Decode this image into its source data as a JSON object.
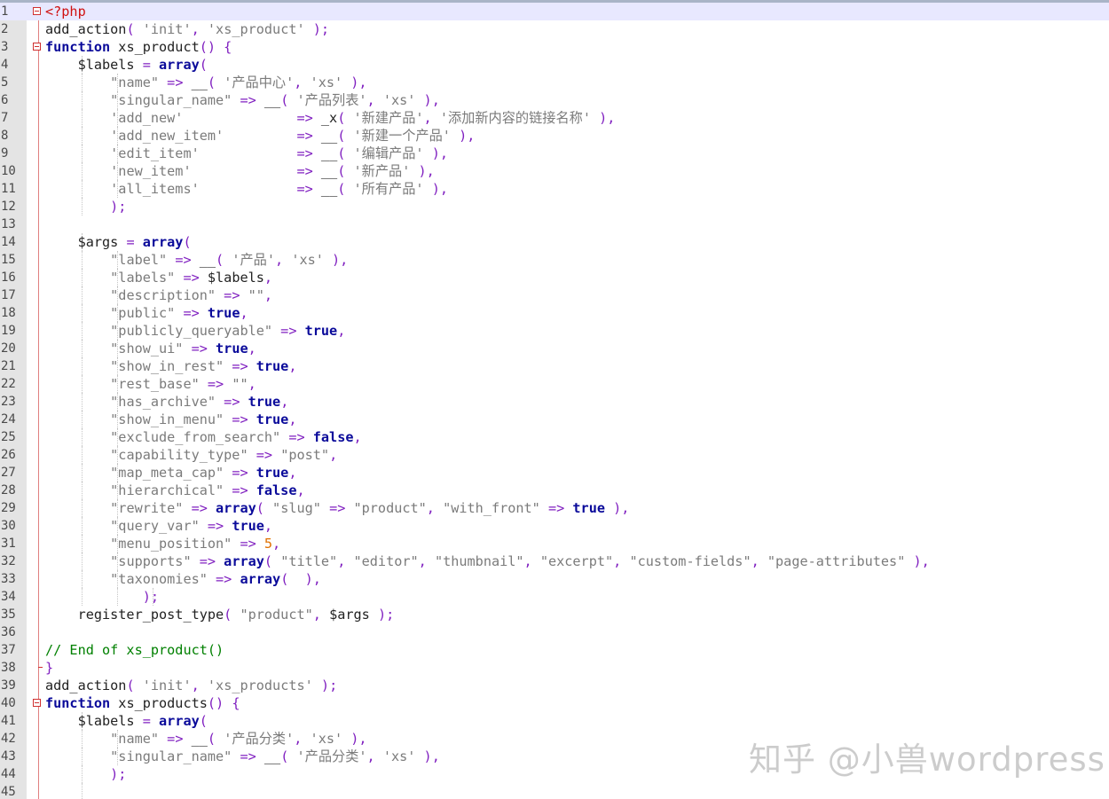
{
  "editor": {
    "current_line": 1,
    "line_numbers": [
      "1",
      "2",
      "3",
      "4",
      "5",
      "6",
      "7",
      "8",
      "9",
      "10",
      "11",
      "12",
      "13",
      "14",
      "15",
      "16",
      "17",
      "18",
      "19",
      "20",
      "21",
      "22",
      "23",
      "24",
      "25",
      "26",
      "27",
      "28",
      "29",
      "30",
      "31",
      "32",
      "33",
      "34",
      "35",
      "36",
      "37",
      "38",
      "39",
      "40",
      "41",
      "42",
      "43",
      "44",
      "45"
    ],
    "colors": {
      "keyword": "#0a0a9a",
      "string": "#7b7b7b",
      "operator": "#8020c0",
      "comment": "#008000",
      "number": "#e07000",
      "php_tag": "#d01010",
      "margin": "#e08080"
    },
    "fold_markers": [
      "1",
      "3",
      "40"
    ],
    "lines": [
      [
        [
          "x",
          "<?php"
        ]
      ],
      [
        [
          "t",
          "add_action"
        ],
        [
          "o",
          "( "
        ],
        [
          "s",
          "'init'"
        ],
        [
          "o",
          ", "
        ],
        [
          "s",
          "'xs_product'"
        ],
        [
          "o",
          " );"
        ]
      ],
      [
        [
          "k",
          "function"
        ],
        [
          "t",
          " xs_product"
        ],
        [
          "o",
          "() {"
        ]
      ],
      [
        [
          "t",
          "    $labels "
        ],
        [
          "o",
          "= "
        ],
        [
          "k",
          "array"
        ],
        [
          "o",
          "("
        ]
      ],
      [
        [
          "t",
          "        "
        ],
        [
          "s",
          "\"name\""
        ],
        [
          "o",
          " => "
        ],
        [
          "t",
          "__"
        ],
        [
          "o",
          "( "
        ],
        [
          "s",
          "'产品中心'"
        ],
        [
          "o",
          ", "
        ],
        [
          "s",
          "'xs'"
        ],
        [
          "o",
          " ),"
        ]
      ],
      [
        [
          "t",
          "        "
        ],
        [
          "s",
          "\"singular_name\""
        ],
        [
          "o",
          " => "
        ],
        [
          "t",
          "__"
        ],
        [
          "o",
          "( "
        ],
        [
          "s",
          "'产品列表'"
        ],
        [
          "o",
          ", "
        ],
        [
          "s",
          "'xs'"
        ],
        [
          "o",
          " ),"
        ]
      ],
      [
        [
          "t",
          "        "
        ],
        [
          "s",
          "'add_new'"
        ],
        [
          "t",
          "              "
        ],
        [
          "o",
          "=> "
        ],
        [
          "t",
          "_x"
        ],
        [
          "o",
          "( "
        ],
        [
          "s",
          "'新建产品'"
        ],
        [
          "o",
          ", "
        ],
        [
          "s",
          "'添加新内容的链接名称'"
        ],
        [
          "o",
          " ),"
        ]
      ],
      [
        [
          "t",
          "        "
        ],
        [
          "s",
          "'add_new_item'"
        ],
        [
          "t",
          "         "
        ],
        [
          "o",
          "=> "
        ],
        [
          "t",
          "__"
        ],
        [
          "o",
          "( "
        ],
        [
          "s",
          "'新建一个产品'"
        ],
        [
          "o",
          " ),"
        ]
      ],
      [
        [
          "t",
          "        "
        ],
        [
          "s",
          "'edit_item'"
        ],
        [
          "t",
          "            "
        ],
        [
          "o",
          "=> "
        ],
        [
          "t",
          "__"
        ],
        [
          "o",
          "( "
        ],
        [
          "s",
          "'编辑产品'"
        ],
        [
          "o",
          " ),"
        ]
      ],
      [
        [
          "t",
          "        "
        ],
        [
          "s",
          "'new_item'"
        ],
        [
          "t",
          "             "
        ],
        [
          "o",
          "=> "
        ],
        [
          "t",
          "__"
        ],
        [
          "o",
          "( "
        ],
        [
          "s",
          "'新产品'"
        ],
        [
          "o",
          " ),"
        ]
      ],
      [
        [
          "t",
          "        "
        ],
        [
          "s",
          "'all_items'"
        ],
        [
          "t",
          "            "
        ],
        [
          "o",
          "=> "
        ],
        [
          "t",
          "__"
        ],
        [
          "o",
          "( "
        ],
        [
          "s",
          "'所有产品'"
        ],
        [
          "o",
          " ),"
        ]
      ],
      [
        [
          "t",
          "        "
        ],
        [
          "o",
          ");"
        ]
      ],
      [
        [
          "t",
          ""
        ]
      ],
      [
        [
          "t",
          "    $args "
        ],
        [
          "o",
          "= "
        ],
        [
          "k",
          "array"
        ],
        [
          "o",
          "("
        ]
      ],
      [
        [
          "t",
          "        "
        ],
        [
          "s",
          "\"label\""
        ],
        [
          "o",
          " => "
        ],
        [
          "t",
          "__"
        ],
        [
          "o",
          "( "
        ],
        [
          "s",
          "'产品'"
        ],
        [
          "o",
          ", "
        ],
        [
          "s",
          "'xs'"
        ],
        [
          "o",
          " ),"
        ]
      ],
      [
        [
          "t",
          "        "
        ],
        [
          "s",
          "\"labels\""
        ],
        [
          "o",
          " => "
        ],
        [
          "t",
          "$labels"
        ],
        [
          "o",
          ","
        ]
      ],
      [
        [
          "t",
          "        "
        ],
        [
          "s",
          "\"description\""
        ],
        [
          "o",
          " => "
        ],
        [
          "s",
          "\"\""
        ],
        [
          "o",
          ","
        ]
      ],
      [
        [
          "t",
          "        "
        ],
        [
          "s",
          "\"public\""
        ],
        [
          "o",
          " => "
        ],
        [
          "k",
          "true"
        ],
        [
          "o",
          ","
        ]
      ],
      [
        [
          "t",
          "        "
        ],
        [
          "s",
          "\"publicly_queryable\""
        ],
        [
          "o",
          " => "
        ],
        [
          "k",
          "true"
        ],
        [
          "o",
          ","
        ]
      ],
      [
        [
          "t",
          "        "
        ],
        [
          "s",
          "\"show_ui\""
        ],
        [
          "o",
          " => "
        ],
        [
          "k",
          "true"
        ],
        [
          "o",
          ","
        ]
      ],
      [
        [
          "t",
          "        "
        ],
        [
          "s",
          "\"show_in_rest\""
        ],
        [
          "o",
          " => "
        ],
        [
          "k",
          "true"
        ],
        [
          "o",
          ","
        ]
      ],
      [
        [
          "t",
          "        "
        ],
        [
          "s",
          "\"rest_base\""
        ],
        [
          "o",
          " => "
        ],
        [
          "s",
          "\"\""
        ],
        [
          "o",
          ","
        ]
      ],
      [
        [
          "t",
          "        "
        ],
        [
          "s",
          "\"has_archive\""
        ],
        [
          "o",
          " => "
        ],
        [
          "k",
          "true"
        ],
        [
          "o",
          ","
        ]
      ],
      [
        [
          "t",
          "        "
        ],
        [
          "s",
          "\"show_in_menu\""
        ],
        [
          "o",
          " => "
        ],
        [
          "k",
          "true"
        ],
        [
          "o",
          ","
        ]
      ],
      [
        [
          "t",
          "        "
        ],
        [
          "s",
          "\"exclude_from_search\""
        ],
        [
          "o",
          " => "
        ],
        [
          "k",
          "false"
        ],
        [
          "o",
          ","
        ]
      ],
      [
        [
          "t",
          "        "
        ],
        [
          "s",
          "\"capability_type\""
        ],
        [
          "o",
          " => "
        ],
        [
          "s",
          "\"post\""
        ],
        [
          "o",
          ","
        ]
      ],
      [
        [
          "t",
          "        "
        ],
        [
          "s",
          "\"map_meta_cap\""
        ],
        [
          "o",
          " => "
        ],
        [
          "k",
          "true"
        ],
        [
          "o",
          ","
        ]
      ],
      [
        [
          "t",
          "        "
        ],
        [
          "s",
          "\"hierarchical\""
        ],
        [
          "o",
          " => "
        ],
        [
          "k",
          "false"
        ],
        [
          "o",
          ","
        ]
      ],
      [
        [
          "t",
          "        "
        ],
        [
          "s",
          "\"rewrite\""
        ],
        [
          "o",
          " => "
        ],
        [
          "k",
          "array"
        ],
        [
          "o",
          "( "
        ],
        [
          "s",
          "\"slug\""
        ],
        [
          "o",
          " => "
        ],
        [
          "s",
          "\"product\""
        ],
        [
          "o",
          ", "
        ],
        [
          "s",
          "\"with_front\""
        ],
        [
          "o",
          " => "
        ],
        [
          "k",
          "true"
        ],
        [
          "o",
          " ),"
        ]
      ],
      [
        [
          "t",
          "        "
        ],
        [
          "s",
          "\"query_var\""
        ],
        [
          "o",
          " => "
        ],
        [
          "k",
          "true"
        ],
        [
          "o",
          ","
        ]
      ],
      [
        [
          "t",
          "        "
        ],
        [
          "s",
          "\"menu_position\""
        ],
        [
          "o",
          " => "
        ],
        [
          "n",
          "5"
        ],
        [
          "o",
          ","
        ]
      ],
      [
        [
          "t",
          "        "
        ],
        [
          "s",
          "\"supports\""
        ],
        [
          "o",
          " => "
        ],
        [
          "k",
          "array"
        ],
        [
          "o",
          "( "
        ],
        [
          "s",
          "\"title\""
        ],
        [
          "o",
          ", "
        ],
        [
          "s",
          "\"editor\""
        ],
        [
          "o",
          ", "
        ],
        [
          "s",
          "\"thumbnail\""
        ],
        [
          "o",
          ", "
        ],
        [
          "s",
          "\"excerpt\""
        ],
        [
          "o",
          ", "
        ],
        [
          "s",
          "\"custom-fields\""
        ],
        [
          "o",
          ", "
        ],
        [
          "s",
          "\"page-attributes\""
        ],
        [
          "o",
          " ),"
        ]
      ],
      [
        [
          "t",
          "        "
        ],
        [
          "s",
          "\"taxonomies\""
        ],
        [
          "o",
          " => "
        ],
        [
          "k",
          "array"
        ],
        [
          "o",
          "(  ),"
        ]
      ],
      [
        [
          "t",
          "            "
        ],
        [
          "o",
          ");"
        ]
      ],
      [
        [
          "t",
          "    register_post_type"
        ],
        [
          "o",
          "( "
        ],
        [
          "s",
          "\"product\""
        ],
        [
          "o",
          ", "
        ],
        [
          "t",
          "$args "
        ],
        [
          "o",
          ");"
        ]
      ],
      [
        [
          "t",
          ""
        ]
      ],
      [
        [
          "c",
          "// End of xs_product()"
        ]
      ],
      [
        [
          "o",
          "}"
        ]
      ],
      [
        [
          "t",
          "add_action"
        ],
        [
          "o",
          "( "
        ],
        [
          "s",
          "'init'"
        ],
        [
          "o",
          ", "
        ],
        [
          "s",
          "'xs_products'"
        ],
        [
          "o",
          " );"
        ]
      ],
      [
        [
          "k",
          "function"
        ],
        [
          "t",
          " xs_products"
        ],
        [
          "o",
          "() {"
        ]
      ],
      [
        [
          "t",
          "    $labels "
        ],
        [
          "o",
          "= "
        ],
        [
          "k",
          "array"
        ],
        [
          "o",
          "("
        ]
      ],
      [
        [
          "t",
          "        "
        ],
        [
          "s",
          "\"name\""
        ],
        [
          "o",
          " => "
        ],
        [
          "t",
          "__"
        ],
        [
          "o",
          "( "
        ],
        [
          "s",
          "'产品分类'"
        ],
        [
          "o",
          ", "
        ],
        [
          "s",
          "'xs'"
        ],
        [
          "o",
          " ),"
        ]
      ],
      [
        [
          "t",
          "        "
        ],
        [
          "s",
          "\"singular_name\""
        ],
        [
          "o",
          " => "
        ],
        [
          "t",
          "__"
        ],
        [
          "o",
          "( "
        ],
        [
          "s",
          "'产品分类'"
        ],
        [
          "o",
          ", "
        ],
        [
          "s",
          "'xs'"
        ],
        [
          "o",
          " ),"
        ]
      ],
      [
        [
          "t",
          "        "
        ],
        [
          "o",
          ");"
        ]
      ],
      [
        [
          "t",
          ""
        ]
      ]
    ]
  },
  "watermark": {
    "text": "知乎 @小兽wordpress"
  }
}
